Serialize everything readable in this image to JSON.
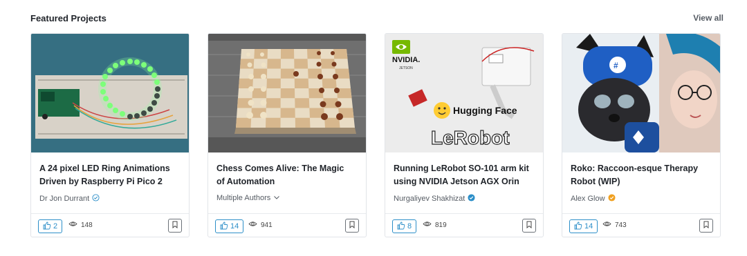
{
  "section": {
    "title": "Featured Projects",
    "view_all": "View all"
  },
  "cards": [
    {
      "title_line1": "A 24 pixel LED Ring Animations",
      "title_line2": "Driven by Raspberry Pi Pico 2",
      "author": "Dr Jon Durrant",
      "author_icon": "verified-outline-icon",
      "likes": "2",
      "views": "148"
    },
    {
      "title_line1": "Chess Comes Alive: The Magic",
      "title_line2": "of Automation",
      "author": "Multiple Authors",
      "author_icon": "chevron-down-icon",
      "likes": "14",
      "views": "941"
    },
    {
      "title_line1": "Running LeRobot SO-101 arm kit",
      "title_line2": "using NVIDIA Jetson AGX Orin",
      "author": "Nurgaliyev Shakhizat",
      "author_icon": "verified-blue-icon",
      "likes": "8",
      "views": "819",
      "thumb_text": {
        "brand": "NVIDIA.",
        "sub": "JETSON",
        "hf": "Hugging Face",
        "lerobot": "LeRobot"
      }
    },
    {
      "title_line1": "Roko: Raccoon-esque Therapy",
      "title_line2": "Robot (WIP)",
      "author": "Alex Glow",
      "author_icon": "verified-orange-icon",
      "likes": "14",
      "views": "743"
    }
  ],
  "colors": {
    "accent": "#2b8ec8",
    "verified_orange": "#f0a020",
    "verified_blue": "#2b8ec8"
  }
}
